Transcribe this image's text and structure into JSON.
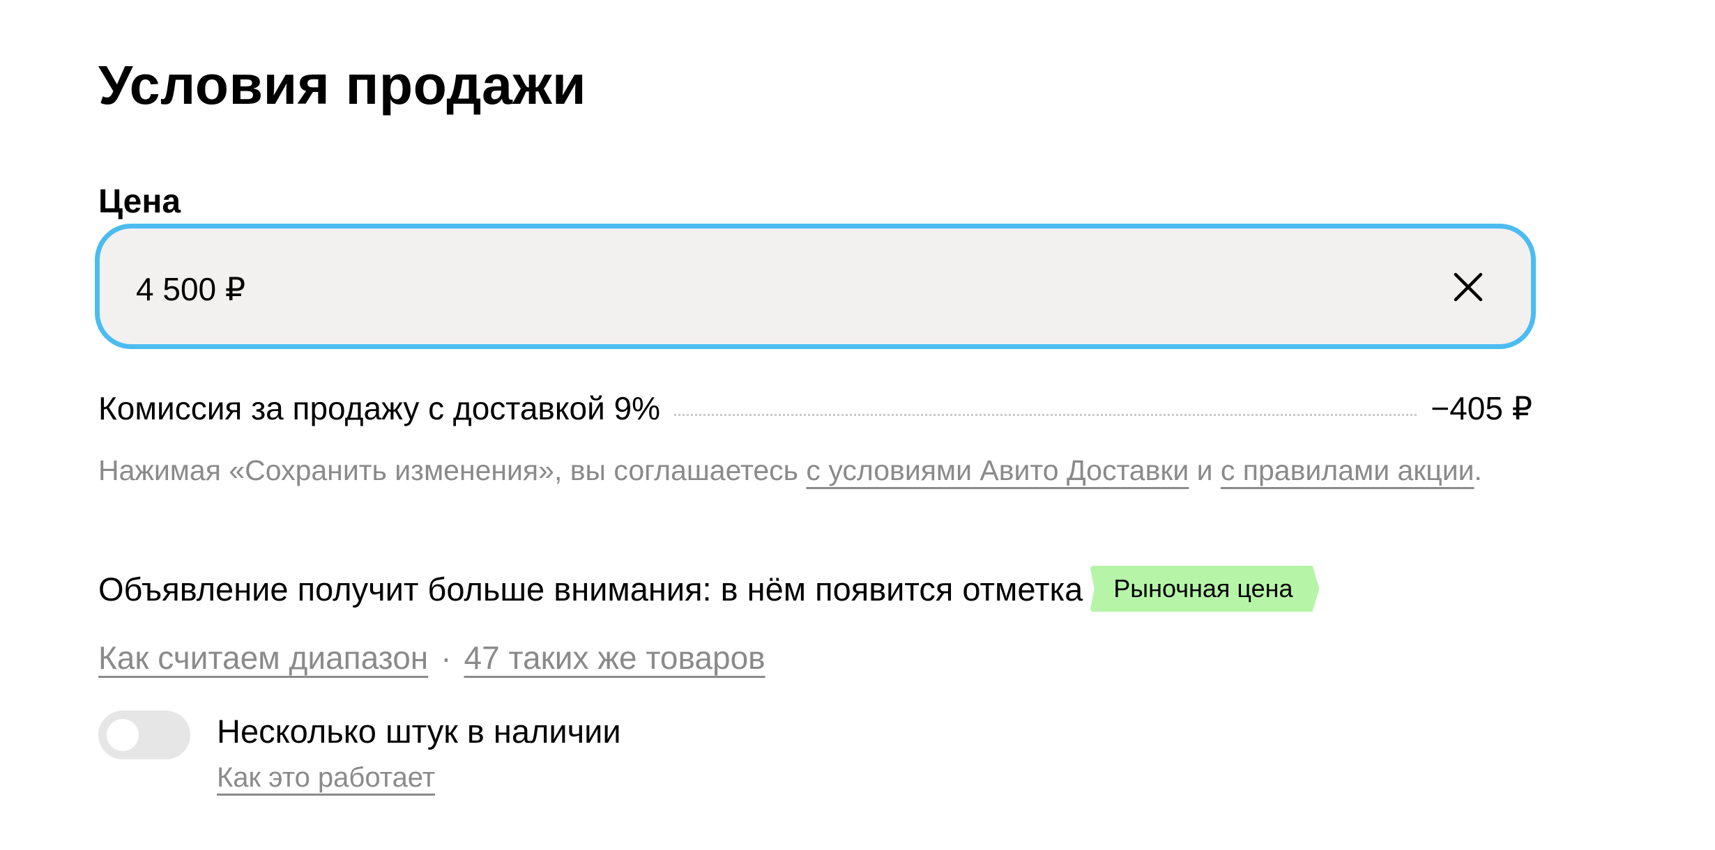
{
  "page": {
    "title": "Условия продажи"
  },
  "price": {
    "label": "Цена",
    "value": "4 500 ₽",
    "clear_icon": "close-icon"
  },
  "commission": {
    "label": "Комиссия за продажу с доставкой 9%",
    "amount": "−405 ₽"
  },
  "consent": {
    "text_before": "Нажимая «Сохранить изменения», вы соглашаетесь ",
    "link_delivery": "с условиями Авито Доставки",
    "text_and": " и ",
    "link_rules": "с правилами акции",
    "text_after": "."
  },
  "attention": {
    "text": "Объявление получит больше внимания: в нём появится отметка",
    "badge": "Рыночная цена",
    "badge_color": "#b6f5a8"
  },
  "links": {
    "range": "Как считаем диапазон",
    "separator": "·",
    "similar": "47 таких же товаров"
  },
  "stock": {
    "toggle_on": false,
    "label": "Несколько штук в наличии",
    "help": "Как это работает"
  },
  "colors": {
    "focus_border": "#4cbcf0",
    "field_bg": "#f2f1f0",
    "muted_text": "#8a8a8a"
  }
}
